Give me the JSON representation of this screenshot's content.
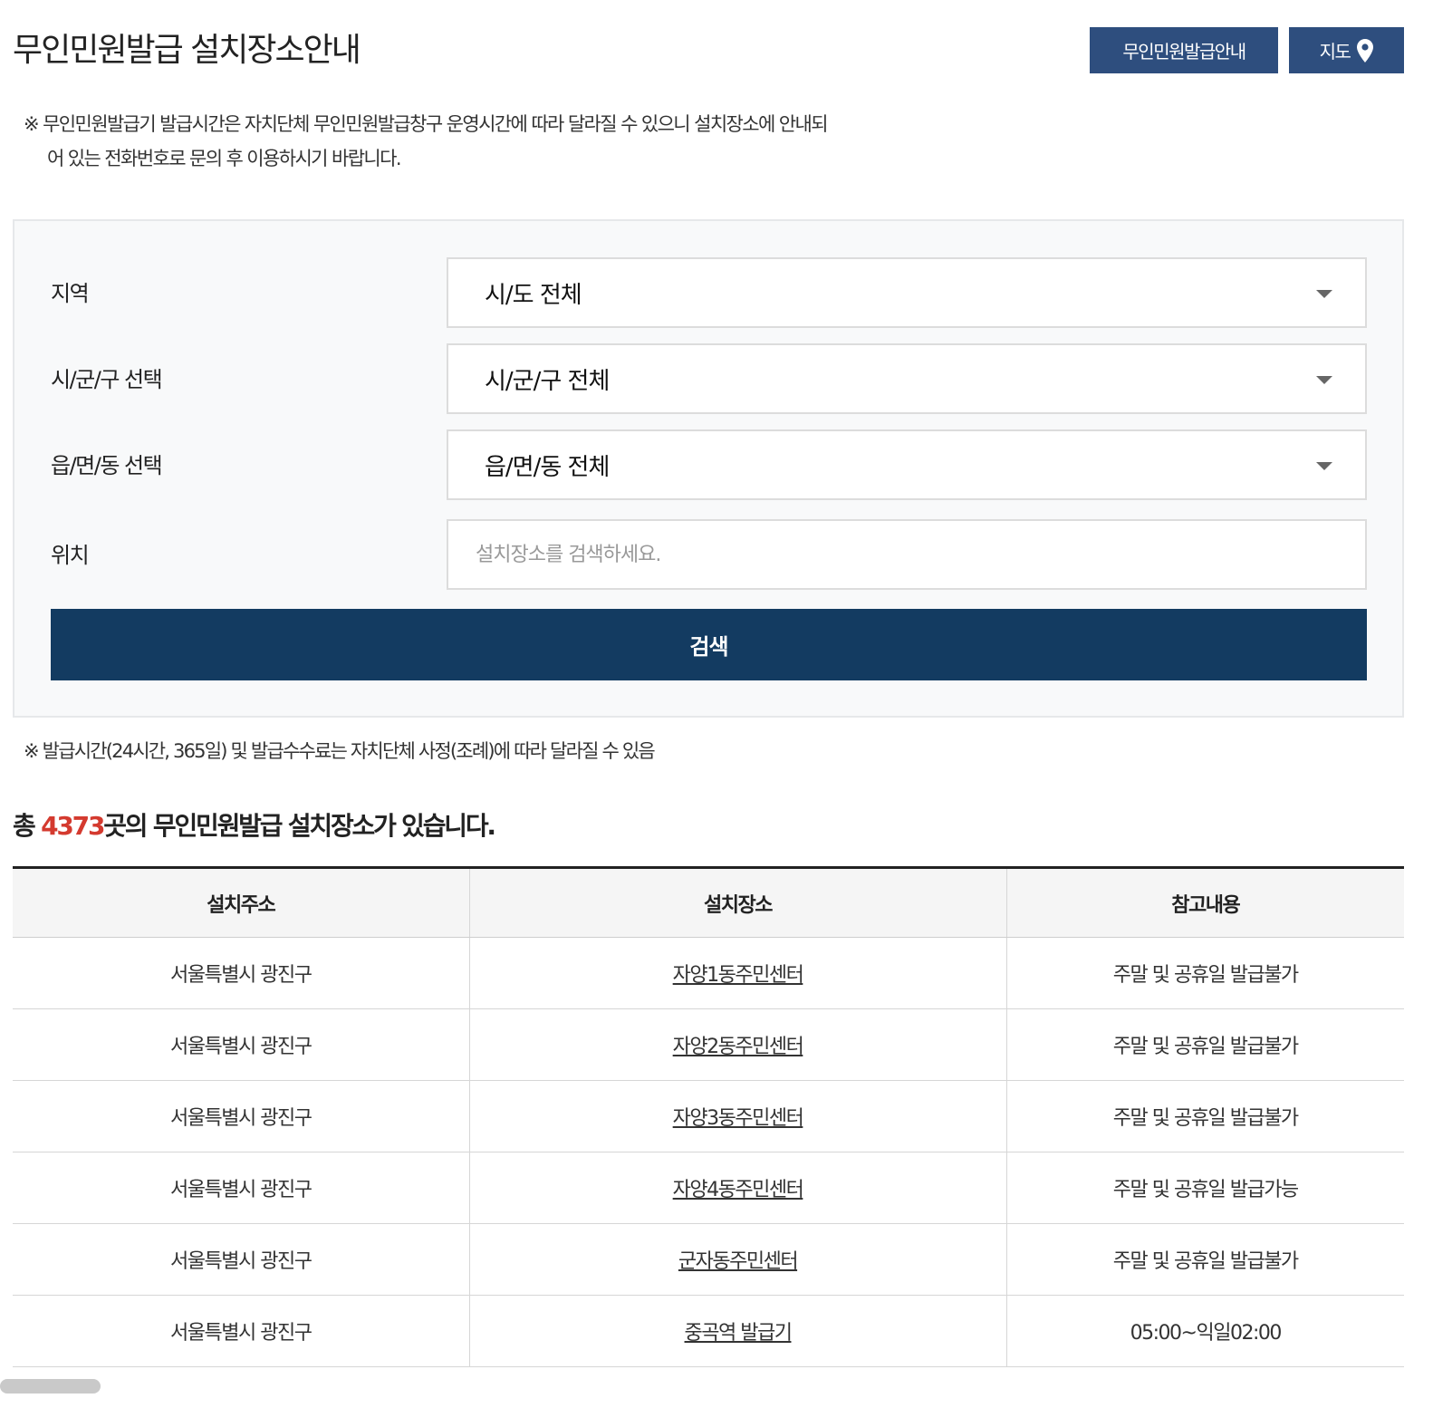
{
  "header": {
    "title": "무인민원발급 설치장소안내",
    "guide_button": "무인민원발급안내",
    "map_button": "지도",
    "map_icon": "map-pin-icon"
  },
  "notice_top": "※ 무인민원발급기 발급시간은 자치단체 무인민원발급창구 운영시간에 따라 달라질 수 있으니 설치장소에 안내되어 있는 전화번호로 문의 후 이용하시기 바랍니다.",
  "search": {
    "region_label": "지역",
    "region_value": "시/도 전체",
    "district_label": "시/군/구 선택",
    "district_value": "시/군/구 전체",
    "town_label": "읍/면/동 선택",
    "town_value": "읍/면/동 전체",
    "location_label": "위치",
    "location_placeholder": "설치장소를 검색하세요.",
    "search_button": "검색",
    "dropdown_icon": "caret-down-icon"
  },
  "notice_bottom": "※ 발급시간(24시간, 365일) 및 발급수수료는 자치단체 사정(조례)에 따라 달라질 수 있음",
  "summary": {
    "prefix": "총 ",
    "count": "4373",
    "suffix": "곳의 무인민원발급 설치장소가 있습니다."
  },
  "table": {
    "headers": [
      "설치주소",
      "설치장소",
      "참고내용"
    ],
    "rows": [
      [
        "서울특별시 광진구",
        "자양1동주민센터",
        "주말 및 공휴일 발급불가"
      ],
      [
        "서울특별시 광진구",
        "자양2동주민센터",
        "주말 및 공휴일 발급불가"
      ],
      [
        "서울특별시 광진구",
        "자양3동주민센터",
        "주말 및 공휴일 발급불가"
      ],
      [
        "서울특별시 광진구",
        "자양4동주민센터",
        "주말 및 공휴일 발급가능"
      ],
      [
        "서울특별시 광진구",
        "군자동주민센터",
        "주말 및 공휴일 발급불가"
      ],
      [
        "서울특별시 광진구",
        "중곡역 발급기",
        "05:00~익일02:00"
      ]
    ]
  },
  "colors": {
    "button_blue": "#2e4e7e",
    "search_button": "#133b61",
    "count_red": "#d43a2f"
  }
}
